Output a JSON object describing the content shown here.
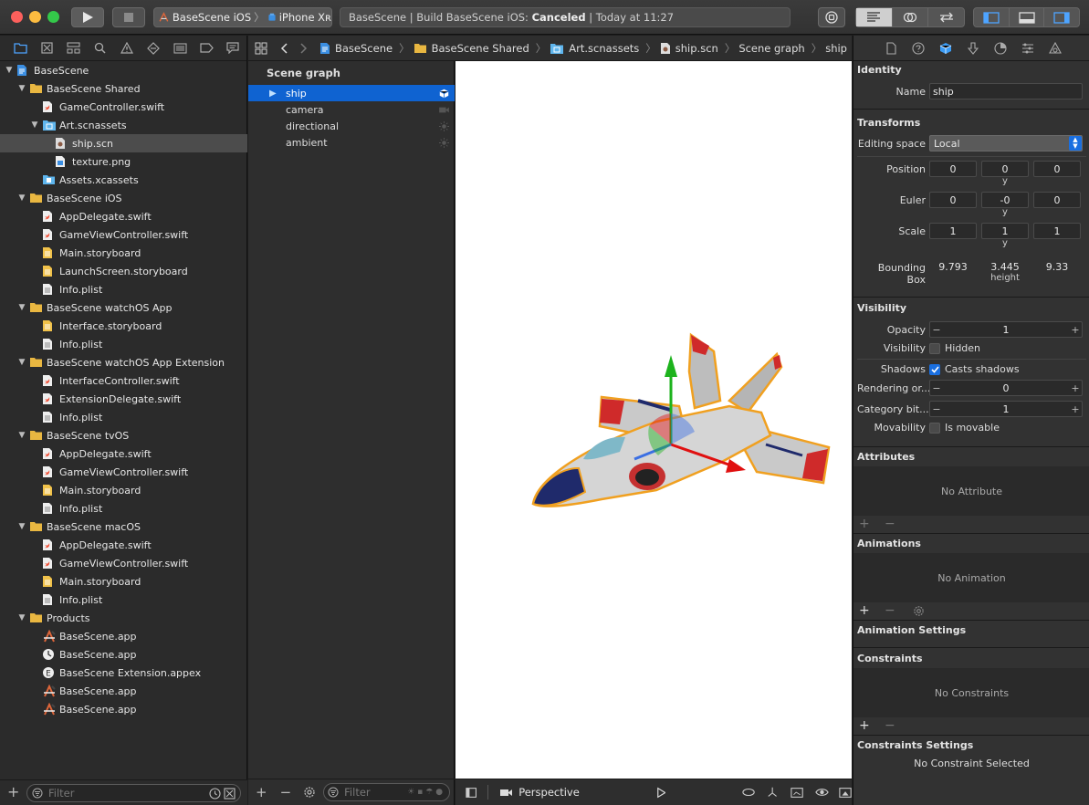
{
  "toolbar": {
    "scheme_target": "BaseScene iOS",
    "scheme_device": "iPhone Xʀ",
    "activity_prefix": "BaseScene | Build BaseScene iOS: ",
    "activity_status": "Canceled",
    "activity_suffix": " | Today at 11:27"
  },
  "navigator": {
    "filter_placeholder": "Filter",
    "items": [
      {
        "label": "BaseScene",
        "icon": "project-icon",
        "depth": 0,
        "expanded": true
      },
      {
        "label": "BaseScene Shared",
        "icon": "folder-icon",
        "depth": 1,
        "expanded": true
      },
      {
        "label": "GameController.swift",
        "icon": "swift-file-icon",
        "depth": 2
      },
      {
        "label": "Art.scnassets",
        "icon": "scnassets-folder-icon",
        "depth": 2,
        "expanded": true
      },
      {
        "label": "ship.scn",
        "icon": "scene-file-icon",
        "depth": 3,
        "selected": true
      },
      {
        "label": "texture.png",
        "icon": "image-file-icon",
        "depth": 3
      },
      {
        "label": "Assets.xcassets",
        "icon": "asset-catalog-icon",
        "depth": 2
      },
      {
        "label": "BaseScene iOS",
        "icon": "folder-icon",
        "depth": 1,
        "expanded": true
      },
      {
        "label": "AppDelegate.swift",
        "icon": "swift-file-icon",
        "depth": 2
      },
      {
        "label": "GameViewController.swift",
        "icon": "swift-file-icon",
        "depth": 2
      },
      {
        "label": "Main.storyboard",
        "icon": "storyboard-file-icon",
        "depth": 2
      },
      {
        "label": "LaunchScreen.storyboard",
        "icon": "storyboard-file-icon",
        "depth": 2
      },
      {
        "label": "Info.plist",
        "icon": "plist-file-icon",
        "depth": 2
      },
      {
        "label": "BaseScene watchOS App",
        "icon": "folder-icon",
        "depth": 1,
        "expanded": true
      },
      {
        "label": "Interface.storyboard",
        "icon": "storyboard-file-icon",
        "depth": 2
      },
      {
        "label": "Info.plist",
        "icon": "plist-file-icon",
        "depth": 2
      },
      {
        "label": "BaseScene watchOS App Extension",
        "icon": "folder-icon",
        "depth": 1,
        "expanded": true
      },
      {
        "label": "InterfaceController.swift",
        "icon": "swift-file-icon",
        "depth": 2
      },
      {
        "label": "ExtensionDelegate.swift",
        "icon": "swift-file-icon",
        "depth": 2
      },
      {
        "label": "Info.plist",
        "icon": "plist-file-icon",
        "depth": 2
      },
      {
        "label": "BaseScene tvOS",
        "icon": "folder-icon",
        "depth": 1,
        "expanded": true
      },
      {
        "label": "AppDelegate.swift",
        "icon": "swift-file-icon",
        "depth": 2
      },
      {
        "label": "GameViewController.swift",
        "icon": "swift-file-icon",
        "depth": 2
      },
      {
        "label": "Main.storyboard",
        "icon": "storyboard-file-icon",
        "depth": 2
      },
      {
        "label": "Info.plist",
        "icon": "plist-file-icon",
        "depth": 2
      },
      {
        "label": "BaseScene macOS",
        "icon": "folder-icon",
        "depth": 1,
        "expanded": true
      },
      {
        "label": "AppDelegate.swift",
        "icon": "swift-file-icon",
        "depth": 2
      },
      {
        "label": "GameViewController.swift",
        "icon": "swift-file-icon",
        "depth": 2
      },
      {
        "label": "Main.storyboard",
        "icon": "storyboard-file-icon",
        "depth": 2
      },
      {
        "label": "Info.plist",
        "icon": "plist-file-icon",
        "depth": 2
      },
      {
        "label": "Products",
        "icon": "folder-icon",
        "depth": 1,
        "expanded": true
      },
      {
        "label": "BaseScene.app",
        "icon": "app-product-icon",
        "depth": 2
      },
      {
        "label": "BaseScene.app",
        "icon": "watch-app-icon",
        "depth": 2
      },
      {
        "label": "BaseScene Extension.appex",
        "icon": "extension-icon",
        "depth": 2
      },
      {
        "label": "BaseScene.app",
        "icon": "app-product-icon",
        "depth": 2
      },
      {
        "label": "BaseScene.app",
        "icon": "app-product-icon",
        "depth": 2
      }
    ]
  },
  "jumpbar": {
    "crumbs": [
      "BaseScene",
      "BaseScene Shared",
      "Art.scnassets",
      "ship.scn",
      "Scene graph",
      "ship"
    ]
  },
  "outline": {
    "title": "Scene graph",
    "nodes": [
      {
        "label": "ship",
        "icon": "cube-icon",
        "selected": true
      },
      {
        "label": "camera",
        "icon": "camera-icon"
      },
      {
        "label": "directional",
        "icon": "light-icon"
      },
      {
        "label": "ambient",
        "icon": "light-icon"
      }
    ],
    "filter_placeholder": "Filter"
  },
  "canvas": {
    "camera_label": "Perspective"
  },
  "inspector": {
    "identity": {
      "title": "Identity",
      "name_label": "Name",
      "name_value": "ship"
    },
    "transforms": {
      "title": "Transforms",
      "editing_space_label": "Editing space",
      "editing_space_value": "Local",
      "position_label": "Position",
      "position": [
        "0",
        "0",
        "0"
      ],
      "euler_label": "Euler",
      "euler": [
        "0",
        "-0",
        "0"
      ],
      "scale_label": "Scale",
      "scale": [
        "1",
        "1",
        "1"
      ],
      "y_label": "y",
      "bbox_label": "Bounding Box",
      "bbox": [
        "9.793",
        "3.445",
        "9.33"
      ],
      "height_label": "height"
    },
    "visibility": {
      "title": "Visibility",
      "opacity_label": "Opacity",
      "opacity": "1",
      "visibility_label": "Visibility",
      "hidden_label": "Hidden",
      "shadows_label": "Shadows",
      "casts_shadows_label": "Casts shadows",
      "rendering_label": "Rendering or...",
      "rendering": "0",
      "category_label": "Category bit...",
      "category": "1",
      "movability_label": "Movability",
      "movable_label": "Is movable",
      "minus": "−",
      "plus": "+"
    },
    "attributes": {
      "title": "Attributes",
      "empty": "No Attribute"
    },
    "animations": {
      "title": "Animations",
      "empty": "No Animation"
    },
    "animation_settings": {
      "title": "Animation Settings"
    },
    "constraints": {
      "title": "Constraints",
      "empty": "No Constraints"
    },
    "constraints_settings": {
      "title": "Constraints Settings",
      "empty": "No Constraint Selected"
    }
  },
  "colors": {
    "accent": "#0f63d1",
    "folder": "#e9b741",
    "swift": "#f05138"
  }
}
